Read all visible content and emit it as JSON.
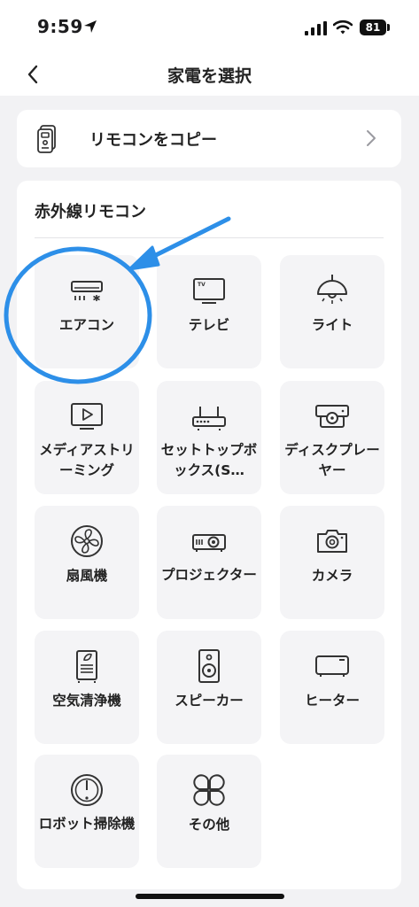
{
  "status": {
    "time": "9:59",
    "battery": "81",
    "colors": {
      "bg": "#ffffff",
      "text": "#111111"
    }
  },
  "nav": {
    "title": "家電を選択",
    "back_icon": "chevron-left-icon"
  },
  "copy": {
    "label": "リモコンをコピー",
    "icon": "remote-icon",
    "chevron": "chevron-right-icon"
  },
  "section": {
    "title": "赤外線リモコン"
  },
  "devices": [
    {
      "id": "aircon",
      "label": "エアコン",
      "icon": "air-conditioner-icon"
    },
    {
      "id": "tv",
      "label": "テレビ",
      "icon": "tv-icon"
    },
    {
      "id": "light",
      "label": "ライト",
      "icon": "ceiling-light-icon"
    },
    {
      "id": "streaming",
      "label": "メディアストリーミング",
      "icon": "streaming-media-icon"
    },
    {
      "id": "settopbox",
      "label": "セットトップボックス(S…",
      "icon": "set-top-box-icon"
    },
    {
      "id": "disc",
      "label": "ディスクプレーヤー",
      "icon": "disc-player-icon"
    },
    {
      "id": "fan",
      "label": "扇風機",
      "icon": "fan-icon"
    },
    {
      "id": "projector",
      "label": "プロジェクター",
      "icon": "projector-icon"
    },
    {
      "id": "camera",
      "label": "カメラ",
      "icon": "camera-icon"
    },
    {
      "id": "purifier",
      "label": "空気清浄機",
      "icon": "air-purifier-icon"
    },
    {
      "id": "speaker",
      "label": "スピーカー",
      "icon": "speaker-icon"
    },
    {
      "id": "heater",
      "label": "ヒーター",
      "icon": "heater-icon"
    },
    {
      "id": "robot",
      "label": "ロボット掃除機",
      "icon": "robot-vacuum-icon"
    },
    {
      "id": "other",
      "label": "その他",
      "icon": "other-icon"
    }
  ],
  "colors": {
    "accent": "#2d8fe8",
    "tile_bg": "#f4f4f6",
    "card_bg": "#ffffff",
    "page_bg": "#f2f2f4"
  }
}
